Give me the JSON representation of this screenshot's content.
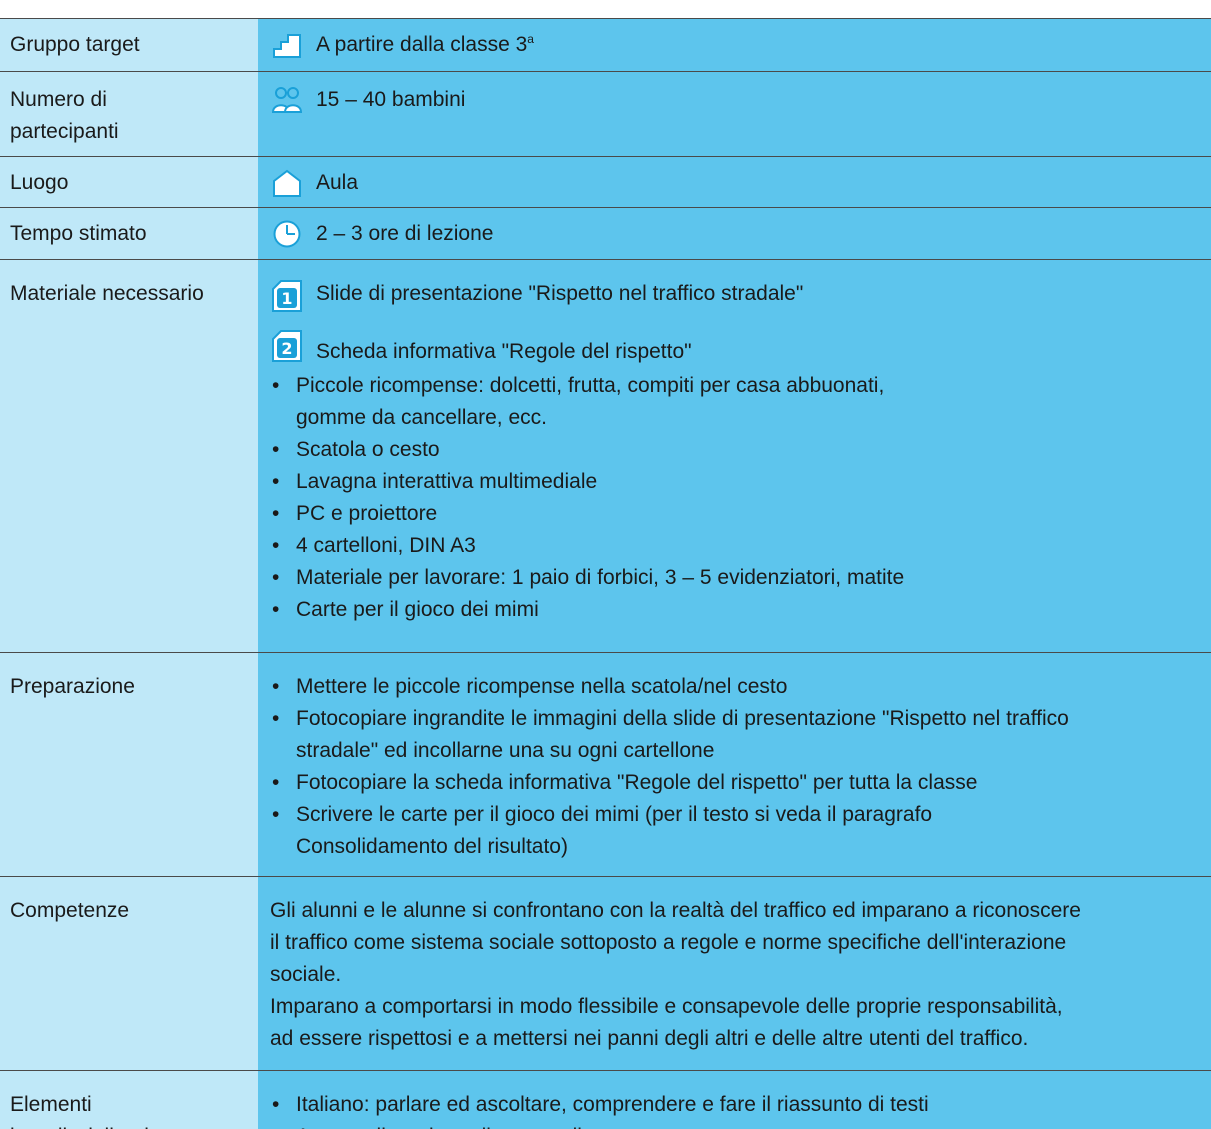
{
  "colors": {
    "label_bg": "#bfe8f8",
    "value_bg": "#5dc5ed",
    "icon": "#1aa0d8",
    "rule": "#4a4a4a"
  },
  "rows": {
    "target": {
      "label": "Gruppo target",
      "icon": "stairs-icon",
      "value": "A partire dalla classe 3",
      "superscript": "a"
    },
    "partecipanti": {
      "label_line1": "Numero di",
      "label_line2": "partecipanti",
      "icon": "group-people-icon",
      "value": "15 – 40 bambini"
    },
    "luogo": {
      "label": "Luogo",
      "icon": "house-icon",
      "value": "Aula"
    },
    "tempo": {
      "label": "Tempo stimato",
      "icon": "clock-icon",
      "value": "2 – 3 ore di lezione"
    },
    "materiale": {
      "label": "Materiale necessario",
      "doc1_number": "1",
      "doc1": "Slide di presentazione \"Rispetto nel traffico stradale\"",
      "doc2_number": "2",
      "doc2": "Scheda informativa \"Regole del rispetto\"",
      "items": [
        "Piccole ricompense: dolcetti, frutta, compiti per casa abbuonati,",
        "Scatola o cesto",
        "Lavagna interattiva multimediale",
        "PC e proiettore",
        "4 cartelloni, DIN A3",
        "Materiale per lavorare: 1 paio di forbici, 3 – 5 evidenziatori, matite",
        "Carte per il gioco dei mimi"
      ],
      "items_cont": [
        "gomme da cancellare, ecc."
      ]
    },
    "preparazione": {
      "label": "Preparazione",
      "items": [
        "Mettere le piccole ricompense nella scatola/nel cesto",
        "Fotocopiare ingrandite le immagini della slide di presentazione \"Rispetto nel traffico",
        "Fotocopiare la scheda informativa \"Regole del rispetto\" per tutta la classe",
        "Scrivere le carte per il gioco dei mimi (per il testo si veda il paragrafo"
      ],
      "items_cont": {
        "1": "stradale\" ed incollarne una su ogni cartellone",
        "3": "Consolidamento del risultato)"
      }
    },
    "competenze": {
      "label": "Competenze",
      "p1": [
        "Gli alunni e le alunne si confrontano con la realtà del traffico ed imparano a riconoscere",
        "il traffico come sistema sociale sottoposto a regole e norme specifiche dell'interazione",
        "sociale."
      ],
      "p2": [
        "Imparano a comportarsi in modo flessibile e consapevole delle proprie responsabilità,",
        "ad essere rispettosi e a mettersi nei panni degli altri e delle altre utenti del traffico."
      ]
    },
    "elementi": {
      "label_line1": "Elementi",
      "label_line2": "interdisciplinari",
      "items": [
        "Italiano: parlare ed ascoltare, comprendere e fare il riassunto di testi",
        "Arte: realizzazione di un cartellone"
      ]
    }
  }
}
